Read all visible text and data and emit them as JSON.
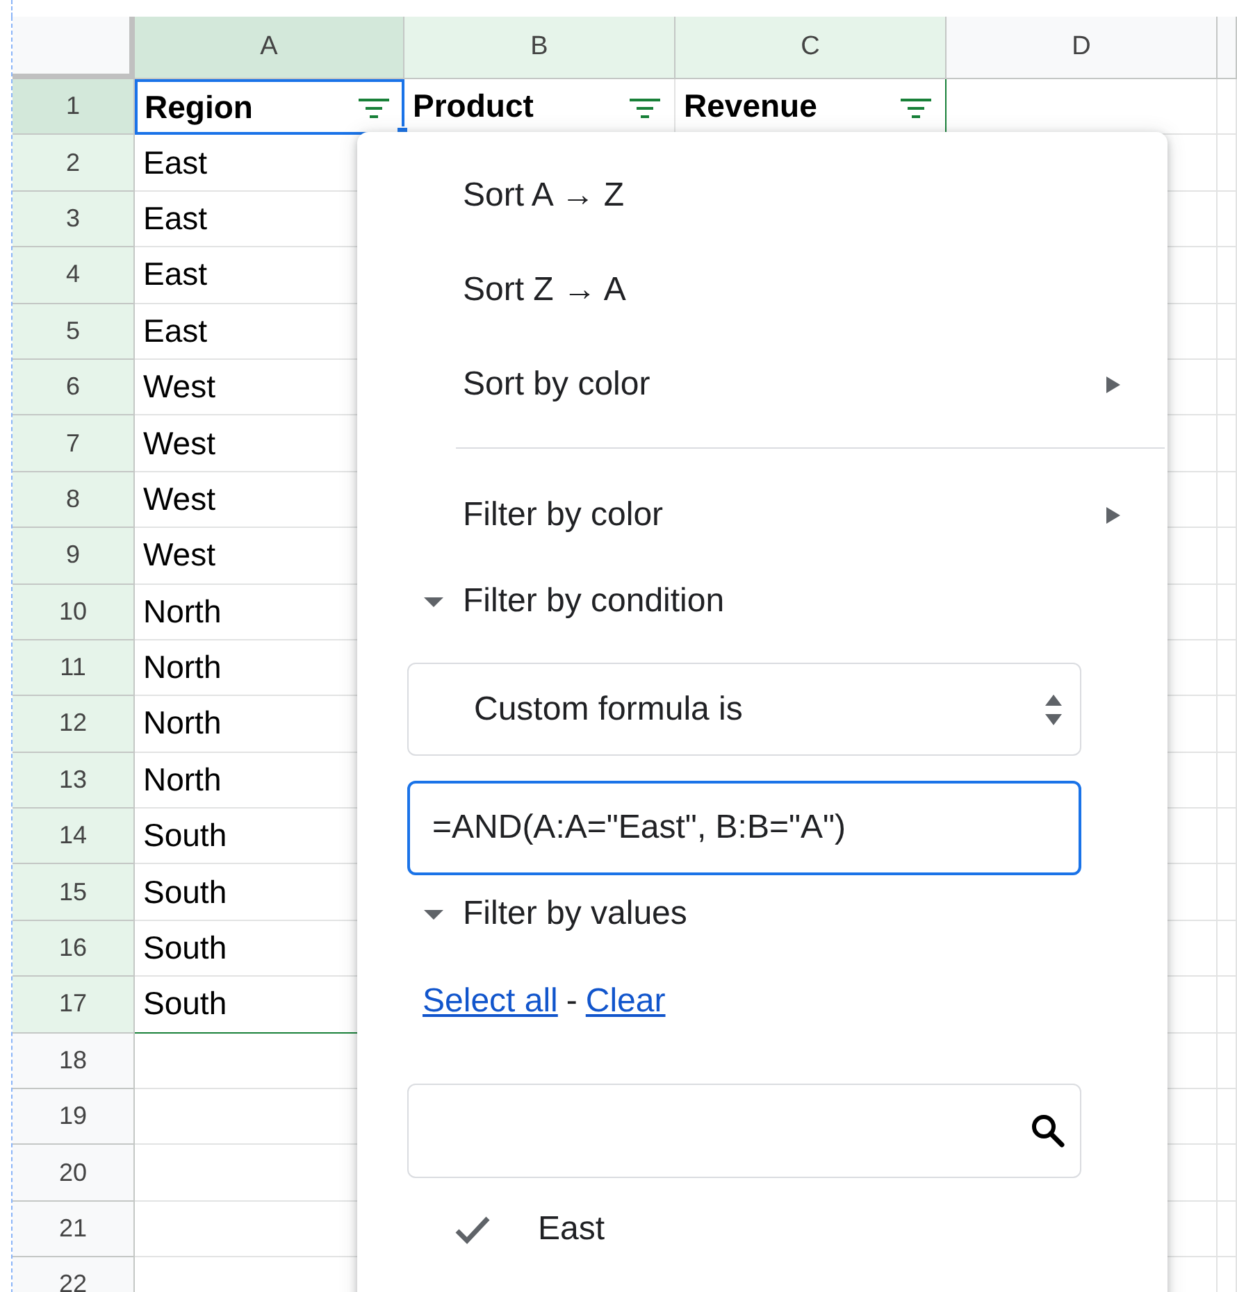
{
  "columns": [
    {
      "label": "A",
      "selected": true,
      "in_filter_range": true
    },
    {
      "label": "B",
      "selected": false,
      "in_filter_range": true
    },
    {
      "label": "C",
      "selected": false,
      "in_filter_range": true
    },
    {
      "label": "D",
      "selected": false,
      "in_filter_range": false
    }
  ],
  "rows": [
    {
      "number": "1",
      "in_filter_range": true,
      "cells": [
        {
          "text": "Region",
          "filter": true,
          "selected": true
        },
        {
          "text": "Product",
          "filter": true,
          "selected": false
        },
        {
          "text": "Revenue",
          "filter": true,
          "selected": false
        }
      ]
    },
    {
      "number": "2",
      "in_filter_range": true,
      "cells": [
        {
          "text": "East"
        }
      ]
    },
    {
      "number": "3",
      "in_filter_range": true,
      "cells": [
        {
          "text": "East"
        }
      ]
    },
    {
      "number": "4",
      "in_filter_range": true,
      "cells": [
        {
          "text": "East"
        }
      ]
    },
    {
      "number": "5",
      "in_filter_range": true,
      "cells": [
        {
          "text": "East"
        }
      ]
    },
    {
      "number": "6",
      "in_filter_range": true,
      "cells": [
        {
          "text": "West"
        }
      ]
    },
    {
      "number": "7",
      "in_filter_range": true,
      "cells": [
        {
          "text": "West"
        }
      ]
    },
    {
      "number": "8",
      "in_filter_range": true,
      "cells": [
        {
          "text": "West"
        }
      ]
    },
    {
      "number": "9",
      "in_filter_range": true,
      "cells": [
        {
          "text": "West"
        }
      ]
    },
    {
      "number": "10",
      "in_filter_range": true,
      "cells": [
        {
          "text": "North"
        }
      ]
    },
    {
      "number": "11",
      "in_filter_range": true,
      "cells": [
        {
          "text": "North"
        }
      ]
    },
    {
      "number": "12",
      "in_filter_range": true,
      "cells": [
        {
          "text": "North"
        }
      ]
    },
    {
      "number": "13",
      "in_filter_range": true,
      "cells": [
        {
          "text": "North"
        }
      ]
    },
    {
      "number": "14",
      "in_filter_range": true,
      "cells": [
        {
          "text": "South"
        }
      ]
    },
    {
      "number": "15",
      "in_filter_range": true,
      "cells": [
        {
          "text": "South"
        }
      ]
    },
    {
      "number": "16",
      "in_filter_range": true,
      "cells": [
        {
          "text": "South"
        }
      ]
    },
    {
      "number": "17",
      "in_filter_range": true,
      "cells": [
        {
          "text": "South"
        }
      ]
    },
    {
      "number": "18",
      "in_filter_range": false,
      "cells": []
    },
    {
      "number": "19",
      "in_filter_range": false,
      "cells": []
    },
    {
      "number": "20",
      "in_filter_range": false,
      "cells": []
    },
    {
      "number": "21",
      "in_filter_range": false,
      "cells": []
    },
    {
      "number": "22",
      "in_filter_range": false,
      "cells": []
    }
  ],
  "filter_menu": {
    "items": [
      {
        "kind": "item",
        "label": "Sort A → Z"
      },
      {
        "kind": "item",
        "label": "Sort Z → A"
      },
      {
        "kind": "submenu",
        "label": "Sort by color"
      },
      {
        "kind": "divider"
      },
      {
        "kind": "submenu",
        "label": "Filter by color"
      },
      {
        "kind": "section",
        "label": "Filter by condition",
        "expanded": true
      },
      {
        "kind": "select",
        "value": "Custom formula is"
      },
      {
        "kind": "input",
        "value": "=AND(A:A=\"East\", B:B=\"A\")",
        "focused": true
      },
      {
        "kind": "section",
        "label": "Filter by values",
        "expanded": true
      },
      {
        "kind": "links",
        "select_all": "Select all",
        "separator": "-",
        "clear": "Clear"
      },
      {
        "kind": "search"
      },
      {
        "kind": "value",
        "label": "East",
        "checked": true
      }
    ]
  }
}
